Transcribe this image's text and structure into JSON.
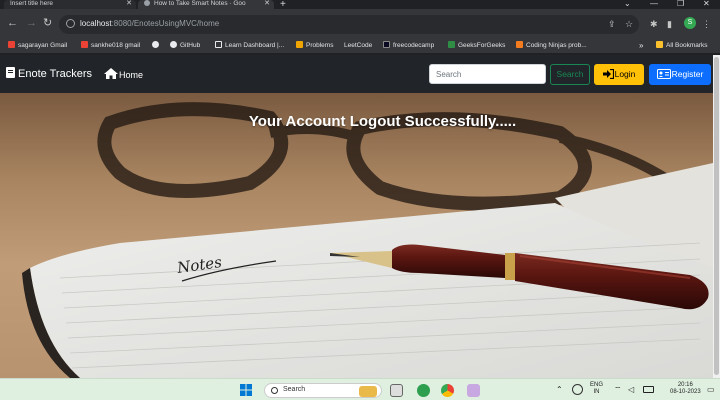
{
  "browser": {
    "tabs": [
      {
        "title": "Insert title here",
        "active": false
      },
      {
        "title": "How to Take Smart Notes · Goo",
        "active": true
      }
    ],
    "url_host": "localhost",
    "url_path": ":8080/EnotesUsingMVC/home",
    "profile_initial": "S",
    "bookmarks": [
      "sagarayan Gmail",
      "sankhe018 gmail",
      "GitHub",
      "Learn Dashboard |...",
      "Problems",
      "LeetCode",
      "freecodecamp",
      "GeeksForGeeks",
      "Coding Ninjas prob...",
      "All Bookmarks"
    ]
  },
  "navbar": {
    "brand": "Enote Trackers",
    "home": "Home",
    "search_placeholder": "Search",
    "search_button": "Search",
    "login_button": "Login",
    "register_button": "Register"
  },
  "hero": {
    "message": "Your Account Logout Successfully.....",
    "notebook_text": "Notes"
  },
  "taskbar": {
    "search_label": "Search",
    "lang_line1": "ENG",
    "lang_line2": "IN",
    "time": "20:16",
    "date": "08-10-2023"
  },
  "colors": {
    "navbar_bg": "#212529",
    "search_btn": "#198754",
    "login_btn": "#ffc107",
    "register_btn": "#0d6efd"
  }
}
